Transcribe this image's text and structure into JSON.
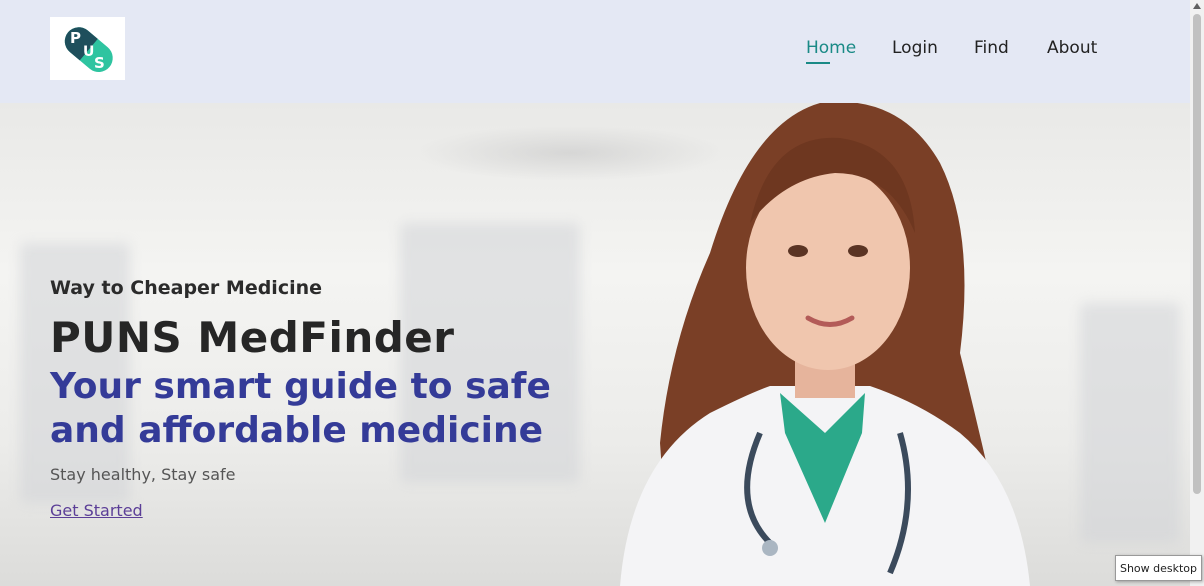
{
  "logo": {
    "alt": "PUNS logo",
    "letters": "PUS"
  },
  "nav": {
    "items": [
      {
        "label": "Home",
        "active": true
      },
      {
        "label": "Login",
        "active": false
      },
      {
        "label": "Find",
        "active": false
      },
      {
        "label": "About",
        "active": false
      }
    ]
  },
  "hero": {
    "eyebrow": "Way to Cheaper Medicine",
    "title": "PUNS MedFinder",
    "tagline": "Your smart guide to safe and affordable medicine",
    "subtitle": "Stay healthy, Stay safe",
    "cta_label": "Get Started"
  },
  "tooltip": {
    "text": "Show desktop"
  },
  "colors": {
    "header_bg": "#e4e8f4",
    "accent": "#1a8a86",
    "tagline": "#343b98",
    "logo_dark": "#1e4f5c",
    "logo_teal": "#2ec4a0"
  }
}
